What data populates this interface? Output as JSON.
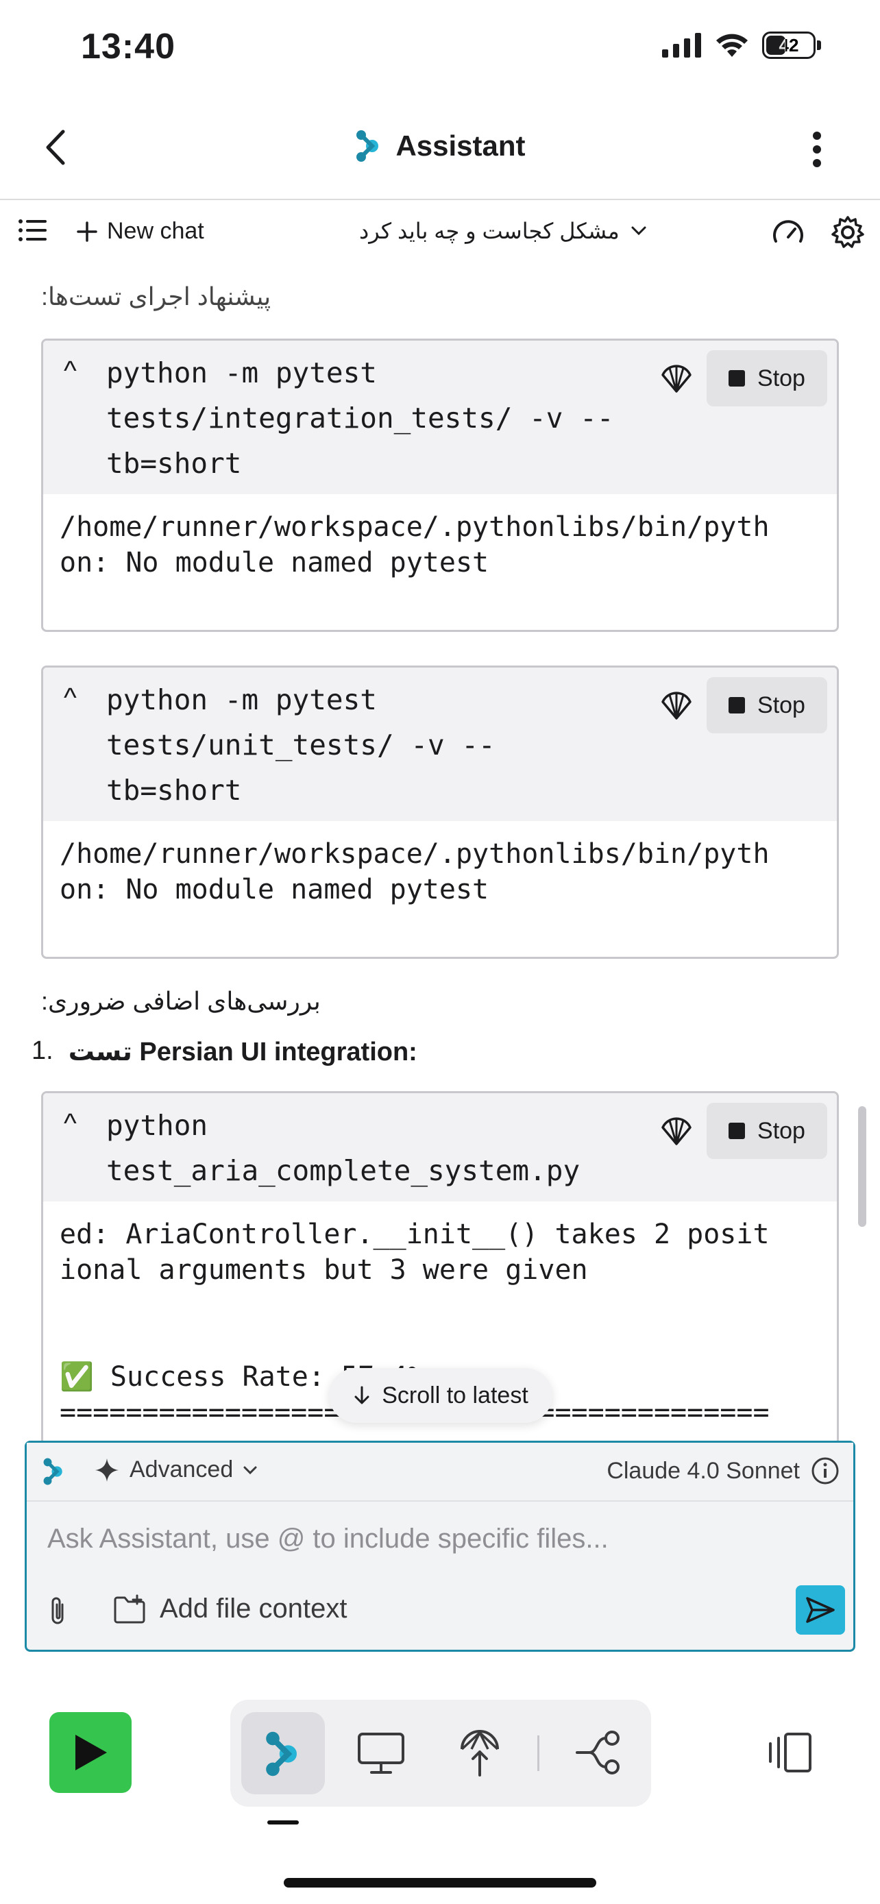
{
  "status_bar": {
    "time": "13:40",
    "battery": "42"
  },
  "header": {
    "title": "Assistant"
  },
  "toolbar": {
    "new_chat": "New chat",
    "chat_title": "مشکل کجاست و چه باید کرد"
  },
  "messages": {
    "intro": "پیشنهاد اجرای تست‌ها:",
    "tools": [
      {
        "command": "python -m pytest\ntests/integration_tests/ -v --\ntb=short",
        "output": "/home/runner/workspace/.pythonlibs/bin/pyth\non: No module named pytest",
        "stop_label": "Stop"
      },
      {
        "command": "python -m pytest\ntests/unit_tests/ -v --\ntb=short",
        "output": "/home/runner/workspace/.pythonlibs/bin/pyth\non: No module named pytest",
        "stop_label": "Stop"
      },
      {
        "command": "python\ntest_aria_complete_system.py",
        "output": "ed: AriaController.__init__() takes 2 posit\nional arguments but 3 were given\n\n\n✅ Success Rate: 57.4%\n===========================================",
        "stop_label": "Stop"
      }
    ],
    "extra_heading": "بررسی‌های اضافی ضروری:",
    "list_item_number": "1.",
    "list_item_text": "تست Persian UI integration:"
  },
  "scroll_to_latest": "Scroll to latest",
  "composer": {
    "mode": "Advanced",
    "model": "Claude 4.0 Sonnet",
    "placeholder": "Ask Assistant, use @ to include specific files...",
    "add_context": "Add file context"
  },
  "colors": {
    "accent": "#27b4d8",
    "run": "#35c54e",
    "border": "#1c8aa6"
  }
}
